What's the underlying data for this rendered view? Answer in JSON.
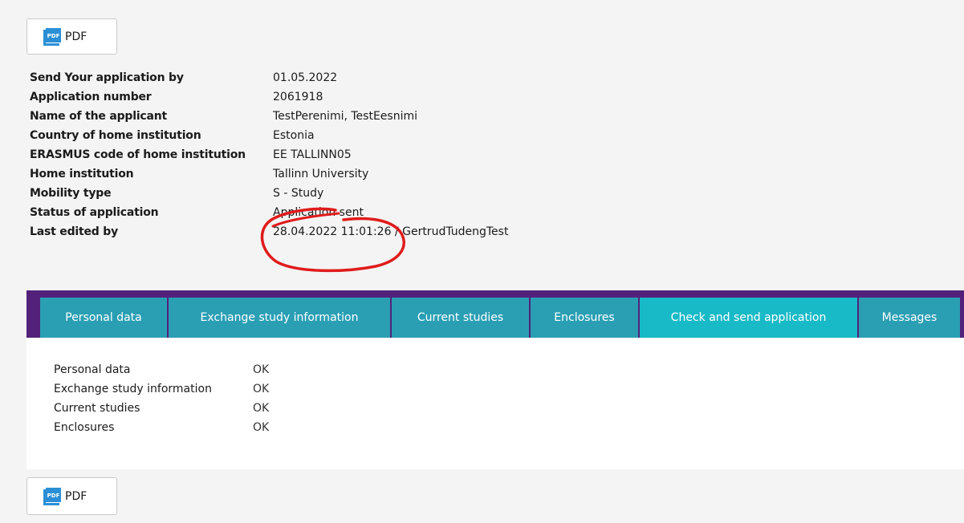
{
  "pdf_top": {
    "icon_text": "PDF",
    "label": "PDF"
  },
  "pdf_bottom": {
    "icon_text": "PDF",
    "label": "PDF"
  },
  "info": [
    {
      "label": "Send Your application by",
      "value": "01.05.2022"
    },
    {
      "label": "Application number",
      "value": "2061918"
    },
    {
      "label": "Name of the applicant",
      "value": "TestPerenimi, TestEesnimi"
    },
    {
      "label": "Country of home institution",
      "value": "Estonia"
    },
    {
      "label": "ERASMUS code of home institution",
      "value": "EE TALLINN05"
    },
    {
      "label": "Home institution",
      "value": "Tallinn University"
    },
    {
      "label": "Mobility type",
      "value": "S - Study"
    },
    {
      "label": "Status of application",
      "value": "Application sent"
    },
    {
      "label": "Last edited by",
      "value": "28.04.2022 11:01:26 / GertrudTudengTest"
    }
  ],
  "tabs": [
    {
      "label": "Personal data"
    },
    {
      "label": "Exchange study information"
    },
    {
      "label": "Current studies"
    },
    {
      "label": "Enclosures"
    },
    {
      "label": "Check and send application"
    },
    {
      "label": "Messages"
    }
  ],
  "checks": [
    {
      "label": "Personal data",
      "value": "OK"
    },
    {
      "label": "Exchange study information",
      "value": "OK"
    },
    {
      "label": "Current studies",
      "value": "OK"
    },
    {
      "label": "Enclosures",
      "value": "OK"
    }
  ],
  "colors": {
    "tab_bar": "#53217a",
    "tab": "#2a9fb4",
    "tab_active": "#18bac7",
    "annotation": "#e01b1b"
  }
}
